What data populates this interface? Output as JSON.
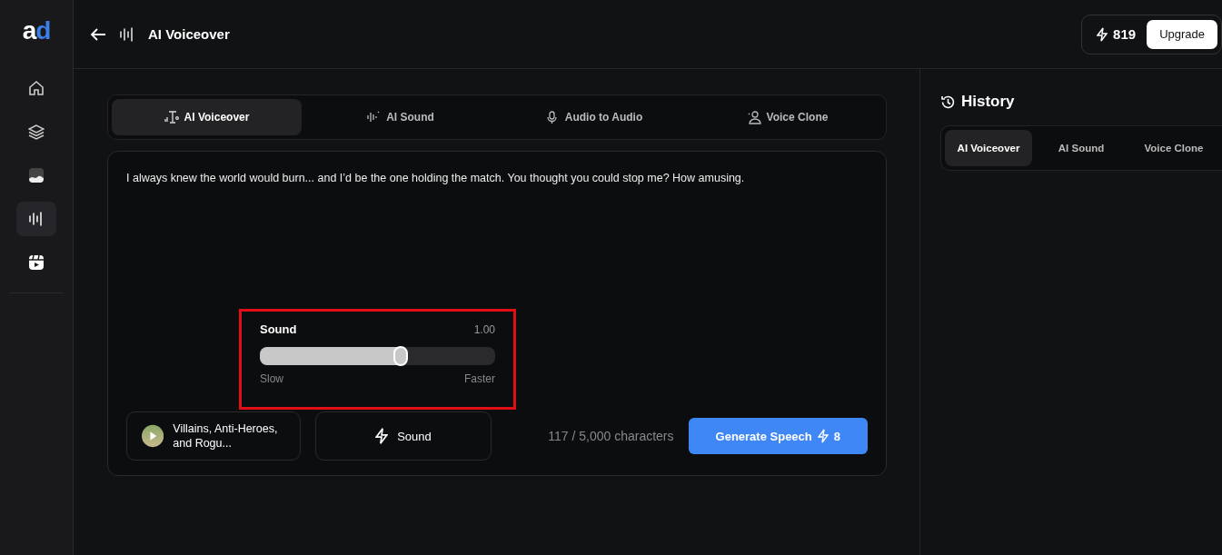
{
  "logo": {
    "first": "a",
    "second": "d"
  },
  "sidebar": {
    "items": [
      {
        "kind": "home",
        "selected": false
      },
      {
        "kind": "layers",
        "selected": false
      },
      {
        "kind": "image",
        "selected": false
      },
      {
        "kind": "wave",
        "selected": true
      },
      {
        "kind": "video",
        "selected": false
      }
    ]
  },
  "header": {
    "title": "AI Voiceover",
    "credits": "819",
    "upgrade": "Upgrade"
  },
  "tabs": [
    {
      "label": "AI Voiceover",
      "kind": "voiceover",
      "selected": true
    },
    {
      "label": "AI Sound",
      "kind": "sound",
      "selected": false
    },
    {
      "label": "Audio to Audio",
      "kind": "mic",
      "selected": false
    },
    {
      "label": "Voice Clone",
      "kind": "clone",
      "selected": false
    }
  ],
  "editor": {
    "text": "I always knew the world would burn... and I’d be the one holding the match. You thought you could stop me? How amusing."
  },
  "slider": {
    "label": "Sound",
    "reading": "1.00",
    "level": 0.6,
    "min_label": "Slow",
    "max_label": "Faster"
  },
  "voice": {
    "name": "Villains, Anti-Heroes, and Rogu..."
  },
  "sound_button": "Sound",
  "counter": "117 / 5,000 characters",
  "generate": {
    "label": "Generate Speech",
    "cost": "8"
  },
  "history": {
    "title": "History",
    "tabs": [
      {
        "label": "AI Voiceover",
        "selected": true
      },
      {
        "label": "AI Sound",
        "selected": false
      },
      {
        "label": "Voice Clone",
        "selected": false
      }
    ]
  }
}
